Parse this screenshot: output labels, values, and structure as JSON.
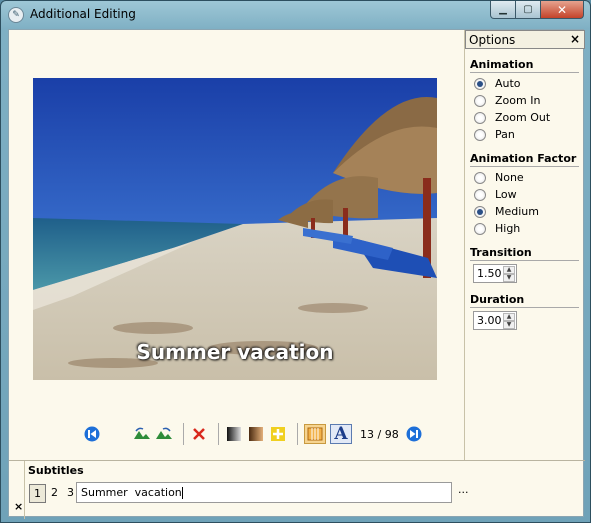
{
  "window": {
    "title": "Additional Editing",
    "min_label": "▭",
    "max_label": "□",
    "close_label": "✕"
  },
  "preview": {
    "overlay_text": "Summer vacation"
  },
  "toolbar": {
    "counter": "13 / 98"
  },
  "options": {
    "title": "Options",
    "close_label": "×",
    "animation": {
      "label": "Animation",
      "items": [
        "Auto",
        "Zoom In",
        "Zoom Out",
        "Pan"
      ],
      "selected": "Auto"
    },
    "animation_factor": {
      "label": "Animation Factor",
      "items": [
        "None",
        "Low",
        "Medium",
        "High"
      ],
      "selected": "Medium"
    },
    "transition": {
      "label": "Transition",
      "value": "1.50"
    },
    "duration": {
      "label": "Duration",
      "value": "3.00"
    }
  },
  "subtitles": {
    "label": "Subtitles",
    "close_label": "×",
    "pages": [
      "1",
      "2",
      "3"
    ],
    "active_page": "1",
    "text": "Summer  vacation",
    "more_label": "..."
  },
  "icons": [
    "prev-icon",
    "rotate-left-icon",
    "rotate-right-icon",
    "delete-icon",
    "grayscale-icon",
    "sepia-icon",
    "brightness-icon",
    "crop-icon",
    "text-icon",
    "next-icon"
  ]
}
